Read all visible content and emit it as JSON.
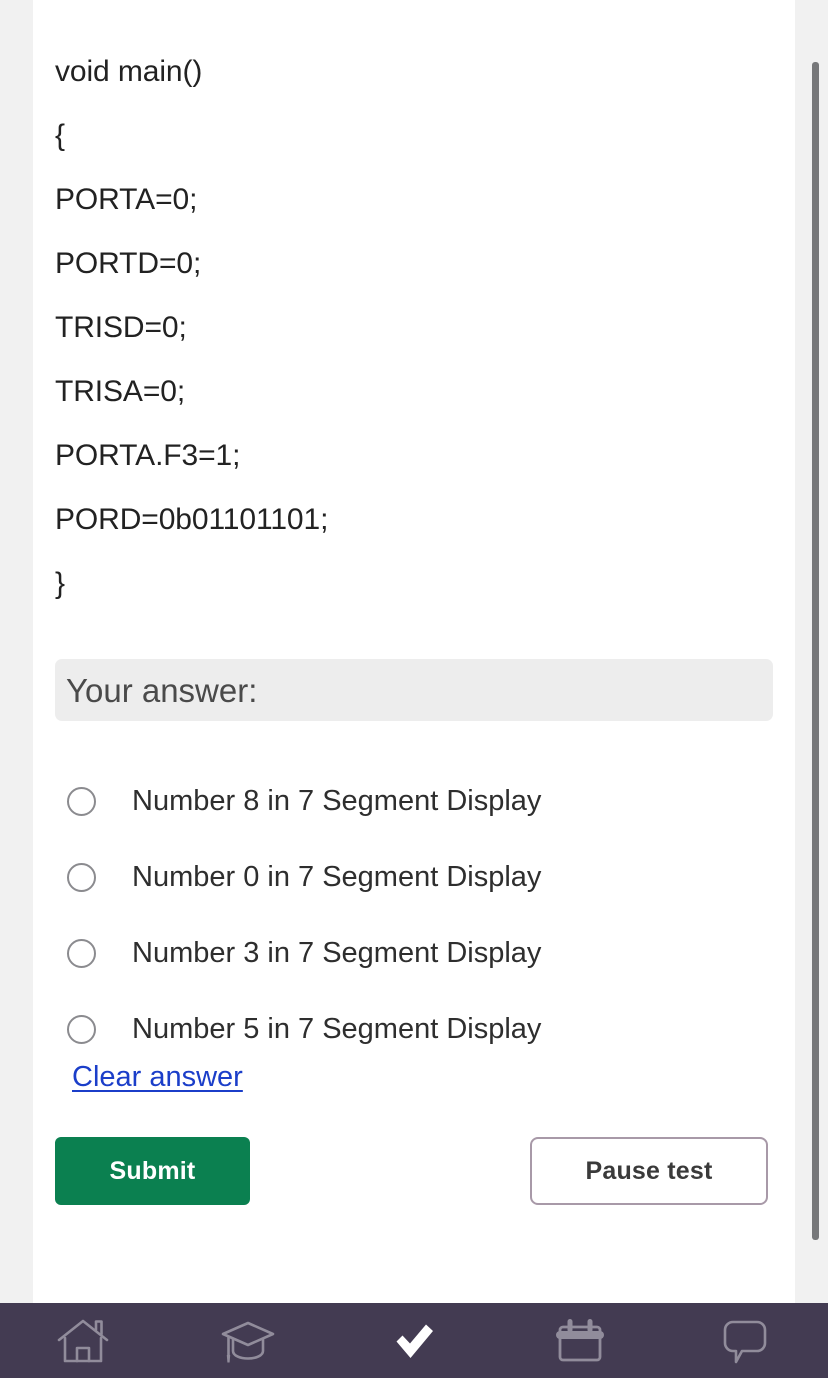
{
  "question": {
    "code_lines": [
      "void main()",
      "{",
      "PORTA=0;",
      "PORTD=0;",
      "TRISD=0;",
      "TRISA=0;",
      "PORTA.F3=1;",
      "PORD=0b01101101;",
      "}"
    ]
  },
  "answer_section": {
    "banner_label": "Your answer:",
    "options": [
      {
        "label": "Number 8 in 7 Segment Display",
        "selected": false
      },
      {
        "label": "Number 0 in 7 Segment Display",
        "selected": false
      },
      {
        "label": "Number 3 in 7 Segment Display",
        "selected": false
      },
      {
        "label": "Number 5 in 7 Segment Display",
        "selected": false
      }
    ],
    "clear_answer_label": "Clear answer"
  },
  "actions": {
    "submit_label": "Submit",
    "pause_label": "Pause test",
    "submit_color": "#0b8050",
    "pause_border_color": "#a899a8"
  },
  "bottom_nav": {
    "background_color": "#433b52",
    "items": [
      {
        "icon": "home-icon",
        "active": false
      },
      {
        "icon": "graduation-cap-icon",
        "active": false
      },
      {
        "icon": "check-icon",
        "active": true
      },
      {
        "icon": "calendar-icon",
        "active": false
      },
      {
        "icon": "chat-bubble-icon",
        "active": false
      }
    ]
  }
}
